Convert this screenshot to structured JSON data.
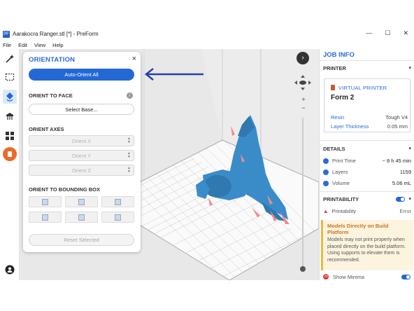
{
  "window": {
    "title": "Aarakocra Ranger.stl [*] - PreForm",
    "logo_text": "PF",
    "minimize": "—",
    "maximize": "☐",
    "close": "✕"
  },
  "menu": [
    "File",
    "Edit",
    "View",
    "Help"
  ],
  "toolbar": {
    "tools": [
      "magic-wand",
      "select",
      "orientation",
      "supports",
      "layout",
      "print"
    ],
    "active": "orientation"
  },
  "orientation_panel": {
    "title": "ORIENTATION",
    "close": "×",
    "auto_orient": "Auto-Orient All",
    "orient_to_face": "ORIENT TO FACE",
    "info": "i",
    "select_base": "Select Base...",
    "orient_axes": "ORIENT AXES",
    "axis_x": "Orient X",
    "axis_y": "Orient Y",
    "axis_z": "Orient Z",
    "bounding_box": "ORIENT TO BOUNDING BOX",
    "reset": "Reset Selected"
  },
  "viewport": {
    "nav_toggle": "›",
    "zoom_in": "+",
    "zoom_out": "−",
    "zoom_level": 0.05,
    "model_color": "#3a8cc9",
    "support_color": "#f08a8a"
  },
  "job_info": {
    "title": "JOB INFO",
    "printer_section": "PRINTER",
    "virtual_printer": "VIRTUAL PRINTER",
    "printer_name": "Form 2",
    "resin_label": "Resin",
    "resin_value": "Tough V4",
    "layer_label": "Layer Thickness",
    "layer_value": "0.05 mm",
    "details_section": "DETAILS",
    "print_time_label": "Print Time",
    "print_time_value": "~ 8 h 45 min",
    "layers_label": "Layers",
    "layers_value": "1159",
    "volume_label": "Volume",
    "volume_value": "5.06 mL",
    "printability_section": "PRINTABILITY",
    "printability_label": "Printability",
    "printability_value": "Error",
    "warning_title": "Models Directly on Build Platform",
    "warning_body": "Models may not print properly when placed directly on the build platform. Using supports to elevate them is recommended.",
    "error_count": "23",
    "show_minima": "Show Minima"
  },
  "colors": {
    "accent": "#2468d6",
    "warning": "#f1b63c",
    "error": "#d9342b",
    "print_orange": "#ec6a2a"
  }
}
